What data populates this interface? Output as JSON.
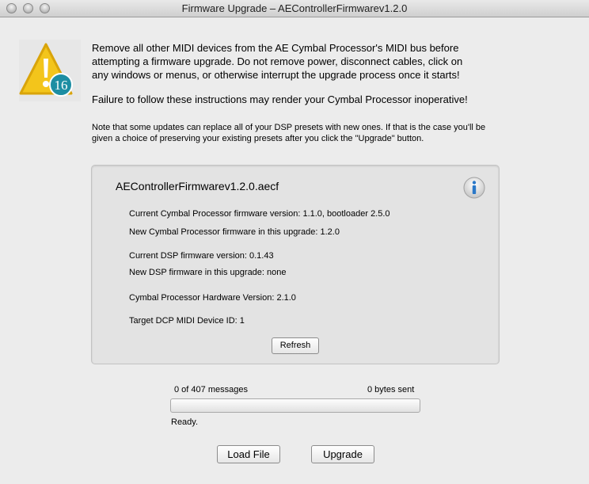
{
  "window": {
    "title": "Firmware Upgrade – AEControllerFirmwarev1.2.0"
  },
  "icon": {
    "name": "warning-icon",
    "badge_number": "16",
    "colors": {
      "triangle": "#f3c51b",
      "badge": "#1d8ea3"
    }
  },
  "warning": {
    "line1": "Remove all other MIDI devices from the AE Cymbal Processor's MIDI bus before",
    "line2": "attempting a firmware upgrade. Do not remove power, disconnect cables, click on",
    "line3": "any windows or menus, or otherwise interrupt the upgrade process once it starts!",
    "failure": "Failure to follow these instructions may render your Cymbal Processor inoperative!"
  },
  "note": {
    "line1": "Note that some updates can replace all of your DSP presets with new ones. If that is the case you'll be",
    "line2": "given a choice of preserving your existing presets after you click the \"Upgrade\" button."
  },
  "info": {
    "filename": "AEControllerFirmwarev1.2.0.aecf",
    "current_cp_fw": "Current Cymbal Processor firmware version: 1.1.0, bootloader 2.5.0",
    "new_cp_fw": "New Cymbal Processor firmware in this upgrade: 1.2.0",
    "current_dsp_fw": "Current DSP firmware version: 0.1.43",
    "new_dsp_fw": "New DSP firmware in this upgrade: none",
    "hw_version": "Cymbal Processor Hardware Version: 2.1.0",
    "device_id": "Target DCP MIDI Device ID: 1",
    "refresh_label": "Refresh"
  },
  "progress": {
    "messages": "0 of 407 messages",
    "bytes": "0 bytes sent",
    "fraction": 0,
    "status": "Ready."
  },
  "buttons": {
    "load_file": "Load File",
    "upgrade": "Upgrade"
  }
}
